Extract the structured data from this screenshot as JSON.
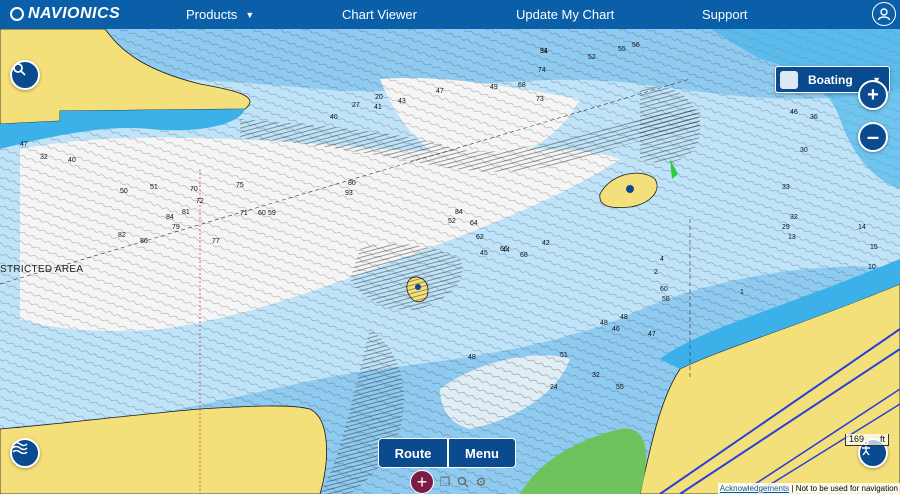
{
  "brand": {
    "logo_text": "NAVIONICS"
  },
  "nav": {
    "products": "Products",
    "chart_viewer": "Chart Viewer",
    "update_my_chart": "Update My Chart",
    "support": "Support"
  },
  "layer_select": {
    "selected": "Boating"
  },
  "map": {
    "area_label": "STRICTED AREA",
    "depth_labels": [
      "51",
      "52",
      "55",
      "56",
      "27",
      "20",
      "40",
      "41",
      "43",
      "47",
      "49",
      "68",
      "73",
      "74",
      "47",
      "32",
      "40",
      "50",
      "51",
      "70",
      "72",
      "75",
      "80",
      "93",
      "84",
      "82",
      "86",
      "84",
      "79",
      "81",
      "77",
      "71",
      "60",
      "59",
      "52",
      "62",
      "64",
      "66",
      "68",
      "42",
      "44",
      "45",
      "48",
      "46",
      "48",
      "47",
      "46",
      "36",
      "30",
      "33",
      "32",
      "29",
      "13",
      "14",
      "15",
      "10",
      "1",
      "4",
      "2",
      "60",
      "58",
      "51",
      "32",
      "55",
      "48",
      "24",
      "34"
    ],
    "scale_label": {
      "value": "169",
      "unit": "ft"
    }
  },
  "actions": {
    "route": "Route",
    "menu": "Menu"
  },
  "footer": {
    "acknowledgements": "Acknowledgements",
    "disclaimer": "Not to be used for navigation"
  }
}
